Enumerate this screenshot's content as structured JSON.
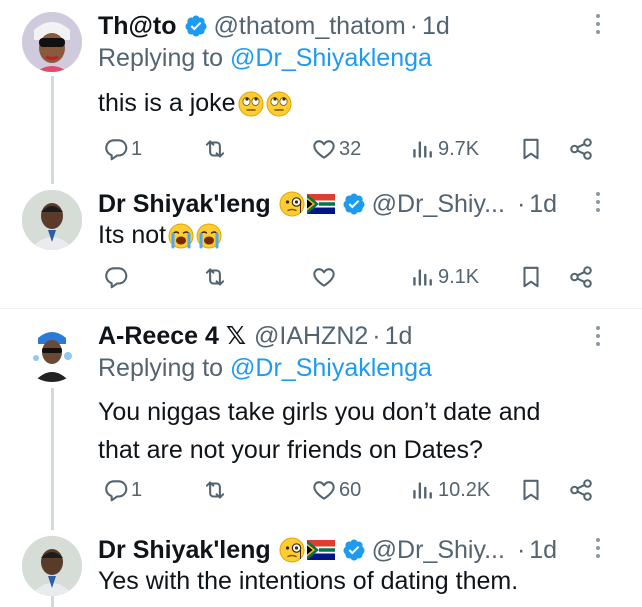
{
  "tweets": [
    {
      "name": "Th@to",
      "handle": "@thatom_thatom",
      "dot": "·",
      "time": "1d",
      "replying_prefix": "Replying to",
      "replying_handle": "@Dr_Shiyaklenga",
      "text": "this is a joke",
      "emojis": [
        "face-with-rolling-eyes",
        "face-with-rolling-eyes"
      ],
      "stats": {
        "replies": "1",
        "retweets": "",
        "likes": "32",
        "views": "9.7K"
      }
    },
    {
      "name": "Dr Shiyak'leng",
      "name_emojis": [
        "face-with-monocle",
        "south-africa-flag"
      ],
      "handle": "@Dr_Shiy...",
      "dot": "·",
      "time": "1d",
      "text": "Its not",
      "emojis": [
        "loudly-crying-face",
        "loudly-crying-face"
      ],
      "stats": {
        "replies": "",
        "retweets": "",
        "likes": "",
        "views": "9.1K"
      }
    },
    {
      "name": "A-Reece 4 𝕏",
      "handle": "@IAHZN2",
      "dot": "·",
      "time": "1d",
      "replying_prefix": "Replying to",
      "replying_handle": "@Dr_Shiyaklenga",
      "text_lines": [
        "You niggas take girls you don’t date and",
        "that are not your friends on Dates?"
      ],
      "stats": {
        "replies": "1",
        "retweets": "",
        "likes": "60",
        "views": "10.2K"
      }
    },
    {
      "name": "Dr Shiyak'leng",
      "name_emojis": [
        "face-with-monocle",
        "south-africa-flag"
      ],
      "handle": "@Dr_Shiy...",
      "dot": "·",
      "time": "1d",
      "text": "Yes with the intentions of dating them."
    }
  ],
  "colors": {
    "verified": "#1d9bf0",
    "mention": "#1d9bf0",
    "secondary_text": "#536471",
    "thread_line": "#cfd9de"
  }
}
